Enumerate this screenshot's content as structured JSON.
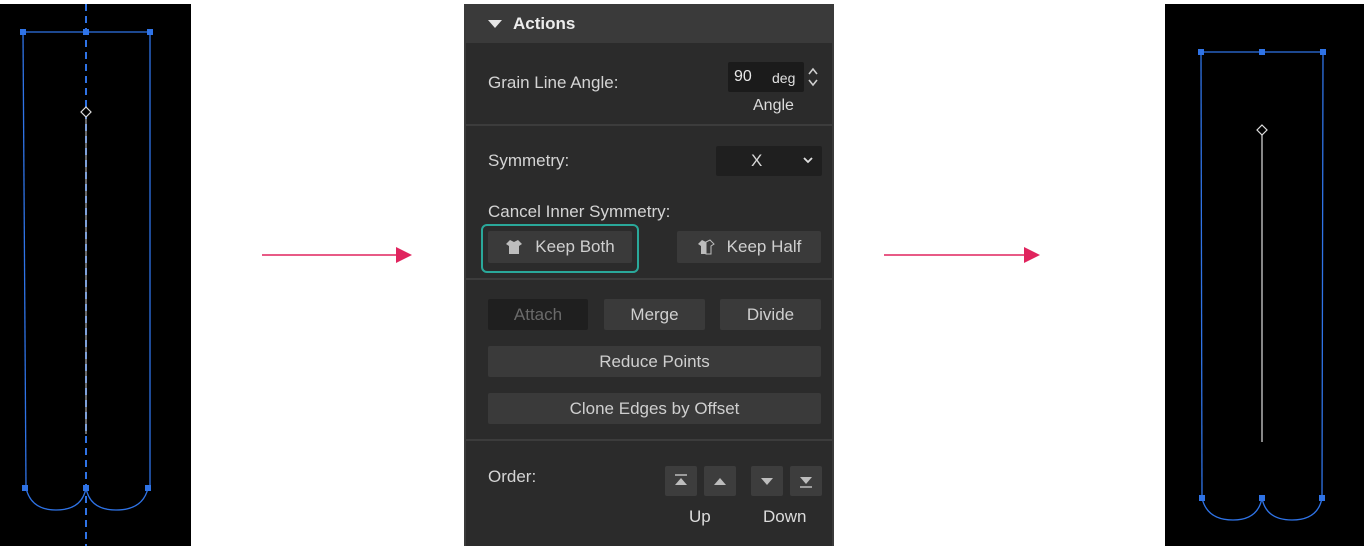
{
  "panel": {
    "title": "Actions",
    "grain_line": {
      "label": "Grain Line Angle:",
      "value": "90",
      "unit": "deg",
      "caption": "Angle"
    },
    "symmetry": {
      "label": "Symmetry:",
      "value": "X"
    },
    "cancel_inner_symmetry": {
      "label": "Cancel Inner Symmetry:",
      "keep_both": "Keep Both",
      "keep_half": "Keep Half"
    },
    "edit": {
      "attach": "Attach",
      "merge": "Merge",
      "divide": "Divide",
      "reduce_points": "Reduce Points",
      "clone_edges": "Clone Edges by Offset"
    },
    "order": {
      "label": "Order:",
      "up": "Up",
      "down": "Down"
    }
  },
  "icons": [
    "shirt-icon",
    "half-shirt-icon",
    "caret-down-icon",
    "chevron-down-icon",
    "spin-up-icon",
    "spin-down-icon",
    "move-top-icon",
    "move-up-icon",
    "move-down-icon",
    "move-bottom-icon",
    "arrow-right-icon"
  ],
  "colors": {
    "accent_highlight": "#2aa89a",
    "pattern_line": "#2f73e6",
    "arrow": "#e0245e",
    "panel_bg": "#2b2b2b"
  }
}
